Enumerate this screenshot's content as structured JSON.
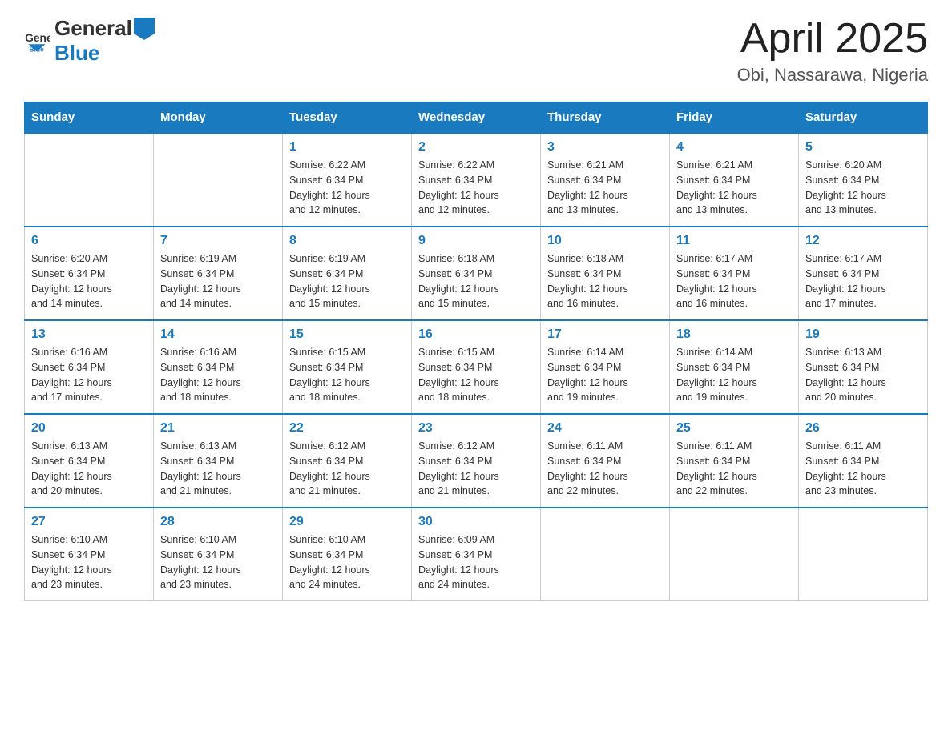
{
  "header": {
    "logo_general": "General",
    "logo_blue": "Blue",
    "month_year": "April 2025",
    "location": "Obi, Nassarawa, Nigeria"
  },
  "weekdays": [
    "Sunday",
    "Monday",
    "Tuesday",
    "Wednesday",
    "Thursday",
    "Friday",
    "Saturday"
  ],
  "weeks": [
    [
      {
        "day": "",
        "info": ""
      },
      {
        "day": "",
        "info": ""
      },
      {
        "day": "1",
        "info": "Sunrise: 6:22 AM\nSunset: 6:34 PM\nDaylight: 12 hours\nand 12 minutes."
      },
      {
        "day": "2",
        "info": "Sunrise: 6:22 AM\nSunset: 6:34 PM\nDaylight: 12 hours\nand 12 minutes."
      },
      {
        "day": "3",
        "info": "Sunrise: 6:21 AM\nSunset: 6:34 PM\nDaylight: 12 hours\nand 13 minutes."
      },
      {
        "day": "4",
        "info": "Sunrise: 6:21 AM\nSunset: 6:34 PM\nDaylight: 12 hours\nand 13 minutes."
      },
      {
        "day": "5",
        "info": "Sunrise: 6:20 AM\nSunset: 6:34 PM\nDaylight: 12 hours\nand 13 minutes."
      }
    ],
    [
      {
        "day": "6",
        "info": "Sunrise: 6:20 AM\nSunset: 6:34 PM\nDaylight: 12 hours\nand 14 minutes."
      },
      {
        "day": "7",
        "info": "Sunrise: 6:19 AM\nSunset: 6:34 PM\nDaylight: 12 hours\nand 14 minutes."
      },
      {
        "day": "8",
        "info": "Sunrise: 6:19 AM\nSunset: 6:34 PM\nDaylight: 12 hours\nand 15 minutes."
      },
      {
        "day": "9",
        "info": "Sunrise: 6:18 AM\nSunset: 6:34 PM\nDaylight: 12 hours\nand 15 minutes."
      },
      {
        "day": "10",
        "info": "Sunrise: 6:18 AM\nSunset: 6:34 PM\nDaylight: 12 hours\nand 16 minutes."
      },
      {
        "day": "11",
        "info": "Sunrise: 6:17 AM\nSunset: 6:34 PM\nDaylight: 12 hours\nand 16 minutes."
      },
      {
        "day": "12",
        "info": "Sunrise: 6:17 AM\nSunset: 6:34 PM\nDaylight: 12 hours\nand 17 minutes."
      }
    ],
    [
      {
        "day": "13",
        "info": "Sunrise: 6:16 AM\nSunset: 6:34 PM\nDaylight: 12 hours\nand 17 minutes."
      },
      {
        "day": "14",
        "info": "Sunrise: 6:16 AM\nSunset: 6:34 PM\nDaylight: 12 hours\nand 18 minutes."
      },
      {
        "day": "15",
        "info": "Sunrise: 6:15 AM\nSunset: 6:34 PM\nDaylight: 12 hours\nand 18 minutes."
      },
      {
        "day": "16",
        "info": "Sunrise: 6:15 AM\nSunset: 6:34 PM\nDaylight: 12 hours\nand 18 minutes."
      },
      {
        "day": "17",
        "info": "Sunrise: 6:14 AM\nSunset: 6:34 PM\nDaylight: 12 hours\nand 19 minutes."
      },
      {
        "day": "18",
        "info": "Sunrise: 6:14 AM\nSunset: 6:34 PM\nDaylight: 12 hours\nand 19 minutes."
      },
      {
        "day": "19",
        "info": "Sunrise: 6:13 AM\nSunset: 6:34 PM\nDaylight: 12 hours\nand 20 minutes."
      }
    ],
    [
      {
        "day": "20",
        "info": "Sunrise: 6:13 AM\nSunset: 6:34 PM\nDaylight: 12 hours\nand 20 minutes."
      },
      {
        "day": "21",
        "info": "Sunrise: 6:13 AM\nSunset: 6:34 PM\nDaylight: 12 hours\nand 21 minutes."
      },
      {
        "day": "22",
        "info": "Sunrise: 6:12 AM\nSunset: 6:34 PM\nDaylight: 12 hours\nand 21 minutes."
      },
      {
        "day": "23",
        "info": "Sunrise: 6:12 AM\nSunset: 6:34 PM\nDaylight: 12 hours\nand 21 minutes."
      },
      {
        "day": "24",
        "info": "Sunrise: 6:11 AM\nSunset: 6:34 PM\nDaylight: 12 hours\nand 22 minutes."
      },
      {
        "day": "25",
        "info": "Sunrise: 6:11 AM\nSunset: 6:34 PM\nDaylight: 12 hours\nand 22 minutes."
      },
      {
        "day": "26",
        "info": "Sunrise: 6:11 AM\nSunset: 6:34 PM\nDaylight: 12 hours\nand 23 minutes."
      }
    ],
    [
      {
        "day": "27",
        "info": "Sunrise: 6:10 AM\nSunset: 6:34 PM\nDaylight: 12 hours\nand 23 minutes."
      },
      {
        "day": "28",
        "info": "Sunrise: 6:10 AM\nSunset: 6:34 PM\nDaylight: 12 hours\nand 23 minutes."
      },
      {
        "day": "29",
        "info": "Sunrise: 6:10 AM\nSunset: 6:34 PM\nDaylight: 12 hours\nand 24 minutes."
      },
      {
        "day": "30",
        "info": "Sunrise: 6:09 AM\nSunset: 6:34 PM\nDaylight: 12 hours\nand 24 minutes."
      },
      {
        "day": "",
        "info": ""
      },
      {
        "day": "",
        "info": ""
      },
      {
        "day": "",
        "info": ""
      }
    ]
  ]
}
